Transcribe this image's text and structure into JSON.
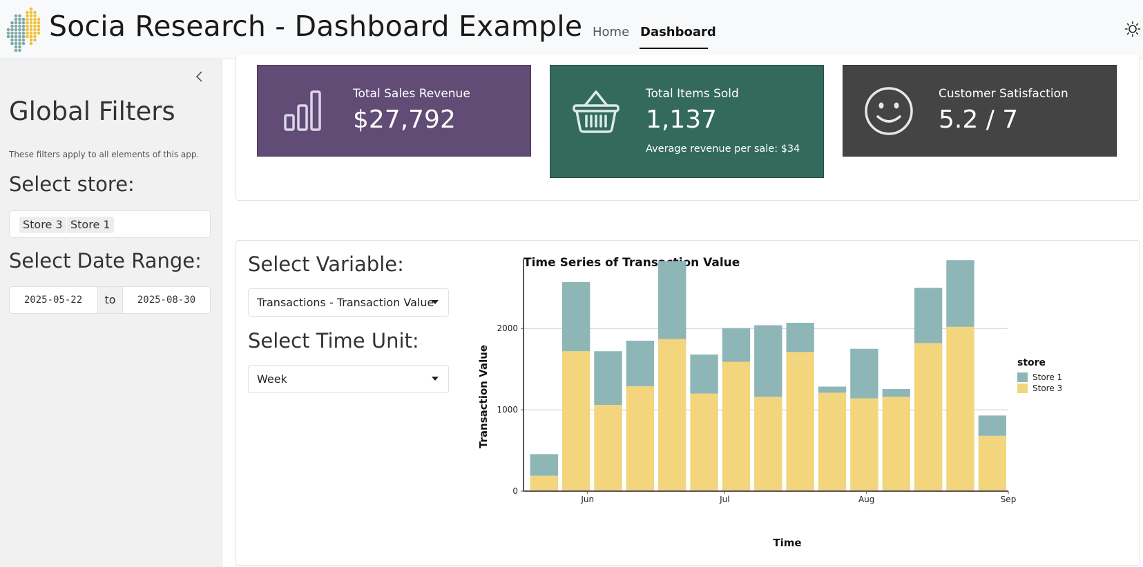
{
  "header": {
    "title": "Socia Research - Dashboard Example",
    "nav": {
      "home": "Home",
      "dashboard": "Dashboard"
    },
    "active_tab": "Dashboard"
  },
  "sidebar": {
    "title": "Global Filters",
    "note": "These filters apply to all elements of this app.",
    "store_label": "Select store:",
    "selected_stores": [
      "Store 3",
      "Store 1"
    ],
    "date_label": "Select Date Range:",
    "date_start": "2025-05-22",
    "date_sep": "to",
    "date_end": "2025-08-30"
  },
  "value_boxes": [
    {
      "title": "Total Sales Revenue",
      "value": "$27,792",
      "icon": "bar-chart-icon",
      "color": "#604c75"
    },
    {
      "title": "Total Items Sold",
      "value": "1,137",
      "subtitle": "Average revenue per sale: $34",
      "icon": "basket-icon",
      "color": "#336a5c"
    },
    {
      "title": "Customer Satisfaction",
      "value": "5.2 / 7",
      "icon": "smiley-icon",
      "color": "#444444"
    }
  ],
  "controls": {
    "variable_label": "Select Variable:",
    "variable_value": "Transactions - Transaction Value",
    "time_unit_label": "Select Time Unit:",
    "time_unit_value": "Week"
  },
  "colors": {
    "store1": "#8fb6b6",
    "store3": "#f3d57e"
  },
  "chart_data": {
    "type": "bar",
    "stacked": true,
    "title": "Time Series of Transaction Value",
    "xlabel": "Time",
    "ylabel": "Transaction Value",
    "legend_title": "store",
    "legend_position": "right",
    "ylim": [
      0,
      2850
    ],
    "yticks": [
      0,
      1000,
      2000
    ],
    "grid": true,
    "xlim": [
      "2025-05-18",
      "2025-09-01"
    ],
    "xticks": [
      {
        "label": "Jun",
        "date": "2025-06-01"
      },
      {
        "label": "Jul",
        "date": "2025-07-01"
      },
      {
        "label": "Aug",
        "date": "2025-08-01"
      },
      {
        "label": "Sep",
        "date": "2025-09-01"
      }
    ],
    "x": [
      "2025-05-19",
      "2025-05-26",
      "2025-06-02",
      "2025-06-09",
      "2025-06-16",
      "2025-06-23",
      "2025-06-30",
      "2025-07-07",
      "2025-07-14",
      "2025-07-21",
      "2025-07-28",
      "2025-08-04",
      "2025-08-11",
      "2025-08-18",
      "2025-08-25"
    ],
    "series": [
      {
        "name": "Store 3",
        "values": [
          190,
          1720,
          1060,
          1290,
          1870,
          1200,
          1590,
          1160,
          1710,
          1210,
          1140,
          1160,
          1820,
          2020,
          680
        ]
      },
      {
        "name": "Store 1",
        "values": [
          265,
          850,
          660,
          560,
          960,
          480,
          415,
          880,
          360,
          75,
          610,
          95,
          680,
          820,
          250
        ]
      }
    ]
  }
}
